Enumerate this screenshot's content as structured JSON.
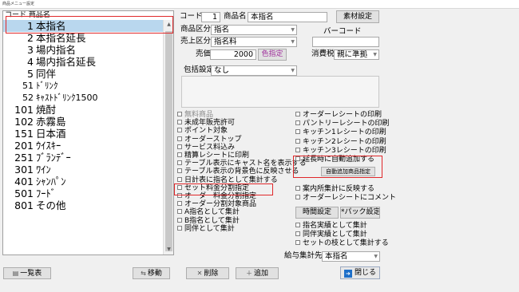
{
  "window": {
    "title": "商品メニュー設定"
  },
  "list": {
    "header_code": "コード",
    "header_name": "商品名",
    "items": [
      {
        "code": "1",
        "name": "本指名"
      },
      {
        "code": "2",
        "name": "本指名延長"
      },
      {
        "code": "3",
        "name": "場内指名"
      },
      {
        "code": "4",
        "name": "場内指名延長"
      },
      {
        "code": "5",
        "name": "同伴"
      },
      {
        "code": "51",
        "name": "ﾄﾞﾘﾝｸ"
      },
      {
        "code": "52",
        "name": "ｷｬｽﾄﾄﾞﾘﾝｸ1500"
      },
      {
        "code": "101",
        "name": "焼酎"
      },
      {
        "code": "102",
        "name": "赤霧島"
      },
      {
        "code": "151",
        "name": "日本酒"
      },
      {
        "code": "201",
        "name": "ｳｲｽｷｰ"
      },
      {
        "code": "251",
        "name": "ﾌﾞﾗﾝﾃﾞｰ"
      },
      {
        "code": "301",
        "name": "ﾜｲﾝ"
      },
      {
        "code": "401",
        "name": "ｼｬﾝﾊﾟﾝ"
      },
      {
        "code": "501",
        "name": "ﾌｰﾄﾞ"
      },
      {
        "code": "801",
        "name": "その他"
      }
    ]
  },
  "form": {
    "code_label": "コード",
    "code_value": "1",
    "name_label": "商品名",
    "name_value": "本指名",
    "material_button": "素材設定",
    "category_label": "商品区分",
    "category_value": "指名",
    "sales_category_label": "売上区分",
    "sales_category_value": "指名料",
    "barcode_label": "バーコード",
    "barcode_value": "",
    "price_label": "売価",
    "price_value": "2000",
    "color_button": "色指定",
    "tax_label": "消費税",
    "tax_value": "親に準拠",
    "bundle_label": "包括設定",
    "bundle_value": "なし"
  },
  "checks_left": [
    {
      "label": "無料商品",
      "disabled": true
    },
    {
      "label": "未成年販売許可"
    },
    {
      "label": "ポイント対象"
    },
    {
      "label": "オーダーストップ"
    },
    {
      "label": "サービス料込み"
    },
    {
      "label": "精算レシートに印刷"
    },
    {
      "label": "テーブル表示にキャスト名を表示する"
    },
    {
      "label": "テーブル表示の背景色に反映させる"
    },
    {
      "label": "日計表に指名として集計する"
    },
    {
      "label": "セット料金分割指定"
    },
    {
      "label": "オーダー料金分割指定"
    },
    {
      "label": "オーダー分割対象商品"
    },
    {
      "label": "A指名として集計"
    },
    {
      "label": "B指名として集計"
    },
    {
      "label": "同伴として集計"
    }
  ],
  "checks_right_top": [
    {
      "label": "オーダーレシートの印刷"
    },
    {
      "label": "パントリーレシートの印刷"
    },
    {
      "label": "キッチン1レシートの印刷"
    },
    {
      "label": "キッチン2レシートの印刷"
    },
    {
      "label": "キッチン3レシートの印刷"
    },
    {
      "label": "延長時に自動追加する"
    }
  ],
  "auto_add_button": "自動追加商品指定",
  "checks_right_mid": [
    {
      "label": "案内所集計に反映する"
    },
    {
      "label": "オーダーレシートにコメント"
    }
  ],
  "time_button": "時間設定",
  "pack_button": "*パック設定*",
  "checks_right_bottom": [
    {
      "label": "指名実績として集計"
    },
    {
      "label": "同伴実績として集計"
    },
    {
      "label": "セットの枝として集計する"
    }
  ],
  "salary": {
    "label": "給与集計先",
    "value": "本指名"
  },
  "footer": {
    "list_button": "一覧表",
    "move_button": "移動",
    "delete_button": "削除",
    "add_button": "追加",
    "close_button": "閉じる"
  },
  "colors": {
    "selection": "#b9d7ee",
    "highlight_border": "#e0282a",
    "color_button_text": "#a0309c",
    "close_icon": "#1d6fc9"
  }
}
